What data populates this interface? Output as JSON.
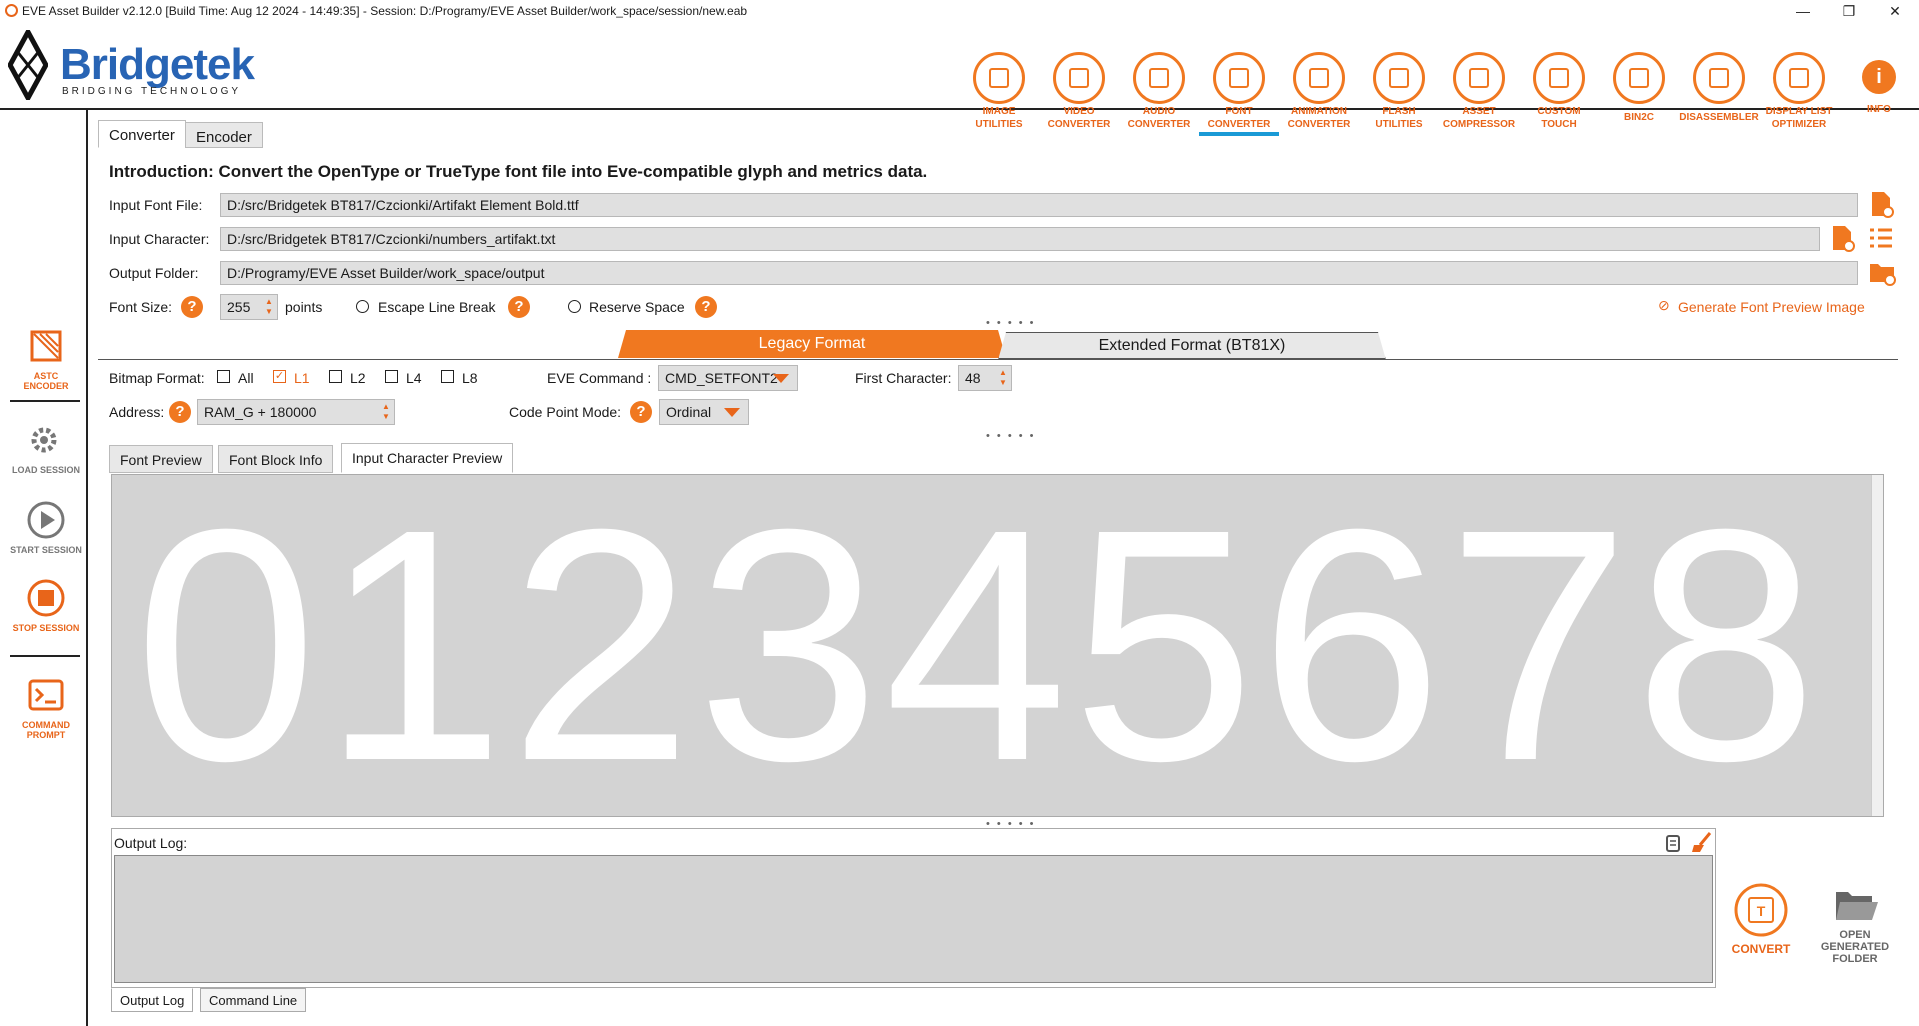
{
  "window": {
    "title": "EVE Asset Builder v2.12.0 [Build Time: Aug 12 2024 - 14:49:35] - Session: D:/Programy/EVE Asset Builder/work_space/session/new.eab",
    "minimize": "—",
    "maximize": "❐",
    "close": "✕"
  },
  "brand": {
    "name": "Bridgetek",
    "tagline": "BRIDGING  TECHNOLOGY"
  },
  "toolbar": [
    {
      "l1": "IMAGE",
      "l2": "UTILITIES"
    },
    {
      "l1": "VIDEO",
      "l2": "CONVERTER"
    },
    {
      "l1": "AUDIO",
      "l2": "CONVERTER"
    },
    {
      "l1": "FONT",
      "l2": "CONVERTER"
    },
    {
      "l1": "ANIMATION",
      "l2": "CONVERTER"
    },
    {
      "l1": "FLASH",
      "l2": "UTILITIES"
    },
    {
      "l1": "ASSET",
      "l2": "COMPRESSOR"
    },
    {
      "l1": "CUSTOM",
      "l2": "TOUCH"
    },
    {
      "l1": "BIN2C",
      "l2": ""
    },
    {
      "l1": "DISASSEMBLER",
      "l2": ""
    },
    {
      "l1": "DISPLAY LIST",
      "l2": "OPTIMIZER"
    },
    {
      "l1": "INFO",
      "l2": ""
    }
  ],
  "sidebar": {
    "astc": {
      "l1": "ASTC",
      "l2": "ENCODER"
    },
    "load": "LOAD SESSION",
    "start": "START SESSION",
    "stop": "STOP SESSION",
    "cmd": {
      "l1": "COMMAND",
      "l2": "PROMPT"
    }
  },
  "tabs": {
    "converter": "Converter",
    "encoder": "Encoder"
  },
  "intro": "Introduction: Convert the OpenType or TrueType font file into Eve-compatible glyph and metrics data.",
  "form": {
    "font_file_label": "Input Font File:",
    "font_file": "D:/src/Bridgetek BT817/Czcionki/Artifakt Element Bold.ttf",
    "char_label": "Input Character:",
    "char_file": "D:/src/Bridgetek BT817/Czcionki/numbers_artifakt.txt",
    "out_label": "Output Folder:",
    "out_folder": "D:/Programy/EVE Asset Builder/work_space/output",
    "size_label": "Font Size:",
    "size": "255",
    "size_unit": "points",
    "escape": "Escape Line Break",
    "reserve": "Reserve Space",
    "preview_img": "Generate Font Preview Image",
    "help": "?"
  },
  "formats": {
    "legacy": "Legacy Format",
    "extended": "Extended Format (BT81X)"
  },
  "bitmap": {
    "label": "Bitmap Format:",
    "all": "All",
    "l1": "L1",
    "l2": "L2",
    "l4": "L4",
    "l8": "L8",
    "eve_cmd_label": "EVE Command :",
    "eve_cmd": "CMD_SETFONT2",
    "first_char_label": "First Character:",
    "first_char": "48",
    "address_label": "Address:",
    "address": "RAM_G + 180000",
    "code_point_label": "Code Point Mode:",
    "code_point": "Ordinal"
  },
  "preview_tabs": {
    "font_preview": "Font Preview",
    "block_info": "Font Block Info",
    "input_char": "Input Character Preview"
  },
  "preview_text": "012345678",
  "log": {
    "label": "Output Log:",
    "tab_log": "Output Log",
    "tab_cmd": "Command Line"
  },
  "actions": {
    "convert": "CONVERT",
    "open_l1": "OPEN",
    "open_l2": "GENERATED",
    "open_l3": "FOLDER"
  },
  "grip": "• • • • •",
  "colors": {
    "accent": "#f07820",
    "brand": "#2864b4",
    "active_underline": "#1a9ad6"
  }
}
